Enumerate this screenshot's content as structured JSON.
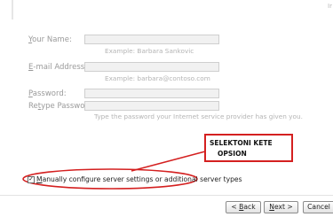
{
  "form": {
    "name_label": {
      "pre": "",
      "key": "Y",
      "post": "our Name:"
    },
    "name_hint": "Example: Barbara Sankovic",
    "email_label": {
      "pre": "",
      "key": "E",
      "post": "-mail Address:"
    },
    "email_hint": "Example: barbara@contoso.com",
    "password_label": {
      "pre": "",
      "key": "P",
      "post": "assword:"
    },
    "retype_label": {
      "pre": "Re",
      "key": "t",
      "post": "ype Password:"
    },
    "password_hint": "Type the password your Internet service provider has given you."
  },
  "annotation": {
    "line1": "SELEKTONI KETE",
    "line2": "OPSION",
    "color": "#d42020"
  },
  "manual_config": {
    "checked": true,
    "check_mark": "✓",
    "label_key": "M",
    "label_rest": "anually configure server settings or additional server types"
  },
  "buttons": {
    "back": {
      "pre": "< ",
      "key": "B",
      "post": "ack"
    },
    "next": {
      "pre": "",
      "key": "N",
      "post": "ext >"
    },
    "cancel": "Cancel"
  },
  "corner_mark": "Ir"
}
